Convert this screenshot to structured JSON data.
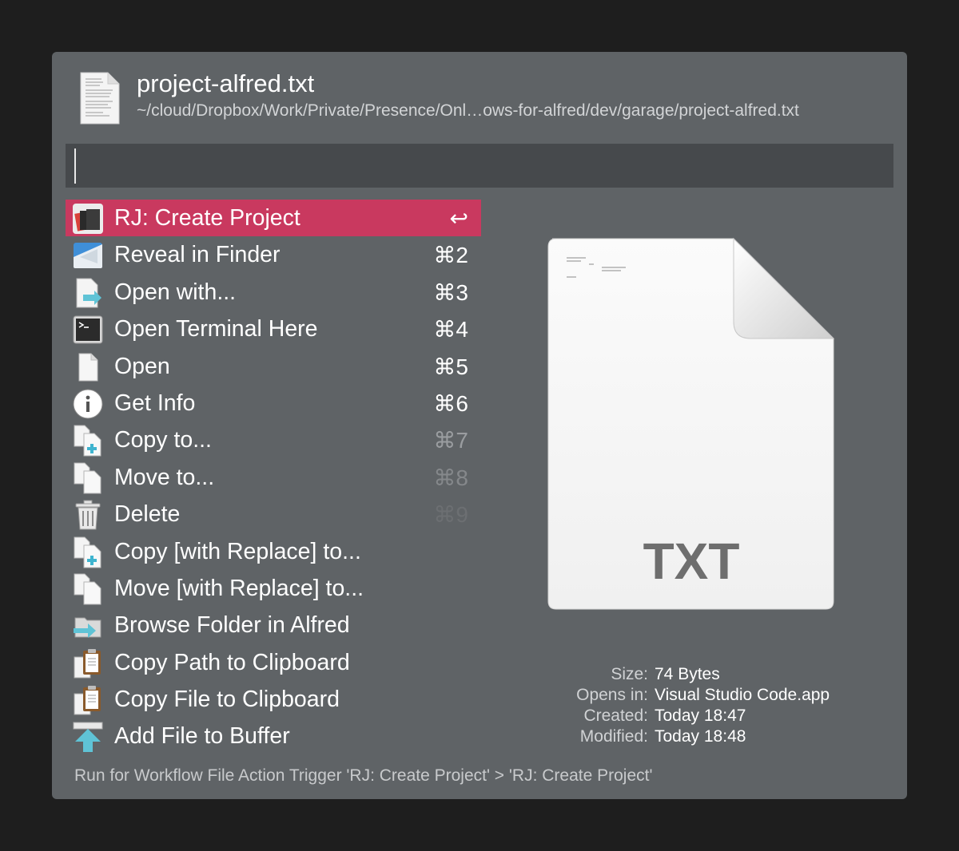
{
  "header": {
    "title": "project-alfred.txt",
    "path": "~/cloud/Dropbox/Work/Private/Presence/Onl…ows-for-alfred/dev/garage/project-alfred.txt"
  },
  "search": {
    "value": ""
  },
  "actions": [
    {
      "label": "RJ: Create Project",
      "shortcut": "↩",
      "icon": "create-project-icon"
    },
    {
      "label": "Reveal in Finder",
      "shortcut": "⌘2",
      "icon": "finder-icon"
    },
    {
      "label": "Open with...",
      "shortcut": "⌘3",
      "icon": "open-with-icon"
    },
    {
      "label": "Open Terminal Here",
      "shortcut": "⌘4",
      "icon": "terminal-icon"
    },
    {
      "label": "Open",
      "shortcut": "⌘5",
      "icon": "document-icon"
    },
    {
      "label": "Get Info",
      "shortcut": "⌘6",
      "icon": "info-icon"
    },
    {
      "label": "Copy to...",
      "shortcut": "⌘7",
      "icon": "copy-to-icon"
    },
    {
      "label": "Move to...",
      "shortcut": "⌘8",
      "icon": "move-to-icon"
    },
    {
      "label": "Delete",
      "shortcut": "⌘9",
      "icon": "trash-icon"
    },
    {
      "label": "Copy [with Replace] to...",
      "shortcut": "",
      "icon": "copy-to-icon"
    },
    {
      "label": "Move [with Replace] to...",
      "shortcut": "",
      "icon": "move-to-icon"
    },
    {
      "label": "Browse Folder in Alfred",
      "shortcut": "",
      "icon": "browse-folder-icon"
    },
    {
      "label": "Copy Path to Clipboard",
      "shortcut": "",
      "icon": "clipboard-icon"
    },
    {
      "label": "Copy File to Clipboard",
      "shortcut": "",
      "icon": "clipboard-icon"
    },
    {
      "label": "Add File to Buffer",
      "shortcut": "",
      "icon": "buffer-arrow-icon"
    }
  ],
  "preview": {
    "type_label": "TXT"
  },
  "info": {
    "size_label": "Size:",
    "size_value": "74 Bytes",
    "opens_label": "Opens in:",
    "opens_value": "Visual Studio Code.app",
    "created_label": "Created:",
    "created_value": "Today 18:47",
    "modified_label": "Modified:",
    "modified_value": "Today 18:48"
  },
  "footer": {
    "text": "Run for Workflow File Action Trigger 'RJ: Create Project' > 'RJ: Create Project'"
  },
  "colors": {
    "selection": "#c9395f",
    "panel": "#5f6366",
    "search": "#46494c"
  }
}
